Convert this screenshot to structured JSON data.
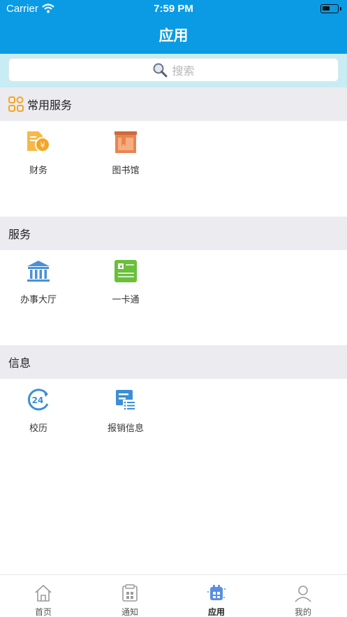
{
  "status_bar": {
    "carrier": "Carrier",
    "time": "7:59 PM"
  },
  "nav": {
    "title": "应用"
  },
  "search": {
    "placeholder": "搜索"
  },
  "sections": [
    {
      "title": "常用服务",
      "items": [
        {
          "label": "财务",
          "icon": "finance-icon"
        },
        {
          "label": "图书馆",
          "icon": "library-icon"
        }
      ]
    },
    {
      "title": "服务",
      "items": [
        {
          "label": "办事大厅",
          "icon": "service-hall-icon"
        },
        {
          "label": "一卡通",
          "icon": "card-icon"
        }
      ]
    },
    {
      "title": "信息",
      "items": [
        {
          "label": "校历",
          "icon": "calendar-24-icon"
        },
        {
          "label": "报销信息",
          "icon": "reimbursement-list-icon"
        }
      ]
    }
  ],
  "tabs": [
    {
      "label": "首页",
      "icon": "home-icon",
      "active": false
    },
    {
      "label": "通知",
      "icon": "notice-icon",
      "active": false
    },
    {
      "label": "应用",
      "icon": "apps-icon",
      "active": true
    },
    {
      "label": "我的",
      "icon": "profile-icon",
      "active": false
    }
  ],
  "colors": {
    "nav_bar": "#0a9be4",
    "search_bg": "#c8ecf3",
    "section_bg": "#ebebf0",
    "accent_blue": "#4a90d9",
    "finance_orange": "#f5a623",
    "library_orange": "#e8854f",
    "card_green": "#6abf3c"
  }
}
